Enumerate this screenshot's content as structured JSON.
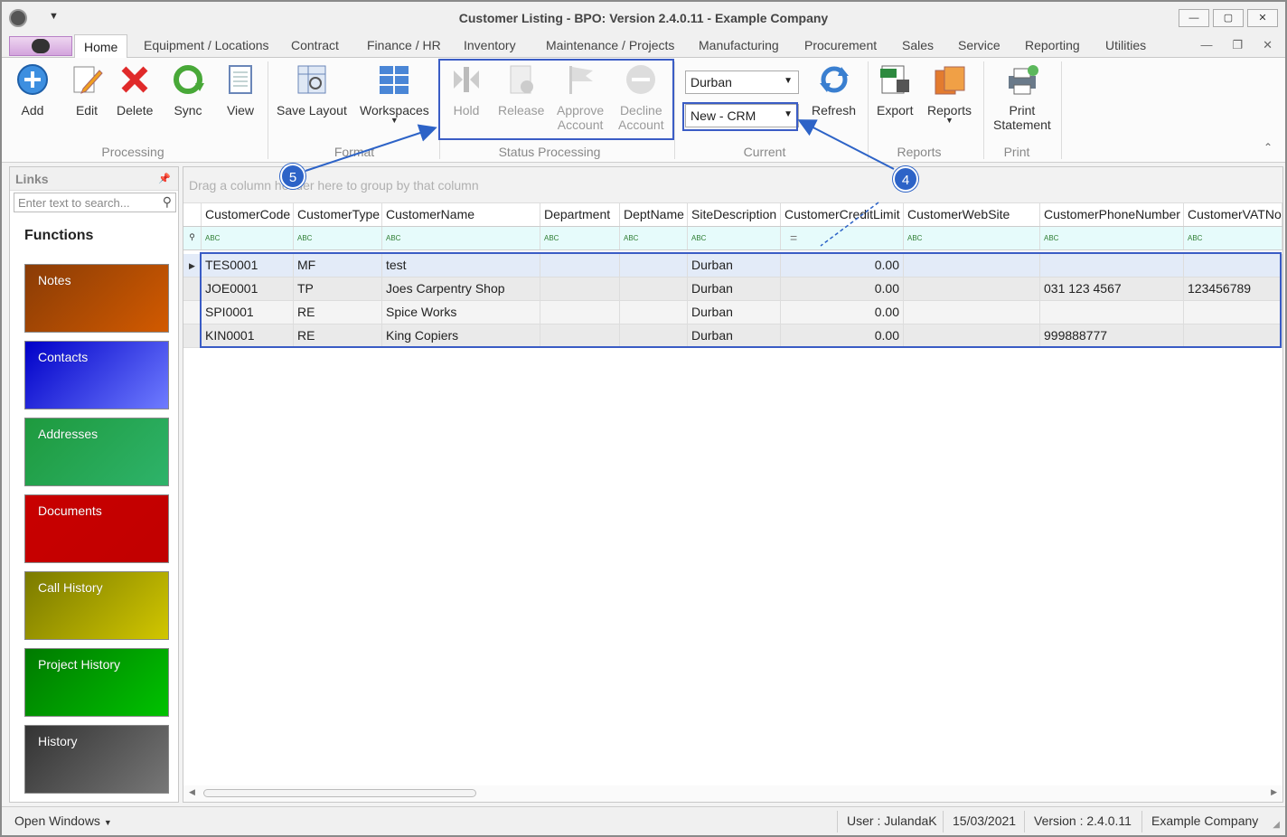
{
  "window": {
    "title": "Customer Listing - BPO: Version 2.4.0.11 - Example Company"
  },
  "tabs": [
    "Home",
    "Equipment / Locations",
    "Contract",
    "Finance / HR",
    "Inventory",
    "Maintenance / Projects",
    "Manufacturing",
    "Procurement",
    "Sales",
    "Service",
    "Reporting",
    "Utilities"
  ],
  "ribbon": {
    "processing": {
      "add": "Add",
      "edit": "Edit",
      "delete": "Delete",
      "sync": "Sync",
      "view": "View",
      "label": "Processing"
    },
    "format": {
      "save_layout": "Save Layout",
      "workspaces": "Workspaces",
      "label": "Format"
    },
    "status_processing": {
      "hold": "Hold",
      "release": "Release",
      "approve_1": "Approve",
      "approve_2": "Account",
      "decline_1": "Decline",
      "decline_2": "Account",
      "label": "Status Processing"
    },
    "current": {
      "site": "Durban",
      "status": "New - CRM",
      "refresh": "Refresh",
      "label": "Current"
    },
    "reports": {
      "export": "Export",
      "reports": "Reports",
      "label": "Reports"
    },
    "print": {
      "print_1": "Print",
      "print_2": "Statement",
      "label": "Print"
    }
  },
  "callouts": {
    "c4": "4",
    "c5": "5"
  },
  "links": {
    "title": "Links",
    "search_placeholder": "Enter text to search...",
    "functions_title": "Functions",
    "tiles": [
      "Notes",
      "Contacts",
      "Addresses",
      "Documents",
      "Call History",
      "Project History",
      "History"
    ]
  },
  "grid": {
    "group_hint": "Drag a column header here to group by that column",
    "columns": [
      "CustomerCode",
      "CustomerType",
      "CustomerName",
      "Department",
      "DeptName",
      "SiteDescription",
      "CustomerCreditLimit",
      "CustomerWebSite",
      "CustomerPhoneNumber",
      "CustomerVATNo"
    ],
    "rows": [
      [
        "TES0001",
        "MF",
        "test",
        "",
        "",
        "Durban",
        "0.00",
        "",
        "",
        ""
      ],
      [
        "JOE0001",
        "TP",
        "Joes Carpentry Shop",
        "",
        "",
        "Durban",
        "0.00",
        "",
        "031 123 4567",
        "123456789"
      ],
      [
        "SPI0001",
        "RE",
        "Spice Works",
        "",
        "",
        "Durban",
        "0.00",
        "",
        "",
        ""
      ],
      [
        "KIN0001",
        "RE",
        "King Copiers",
        "",
        "",
        "Durban",
        "0.00",
        "",
        "999888777",
        ""
      ]
    ]
  },
  "status": {
    "open_windows": "Open Windows",
    "user": "User : JulandaK",
    "date": "15/03/2021",
    "version": "Version : 2.4.0.11",
    "company": "Example Company"
  }
}
